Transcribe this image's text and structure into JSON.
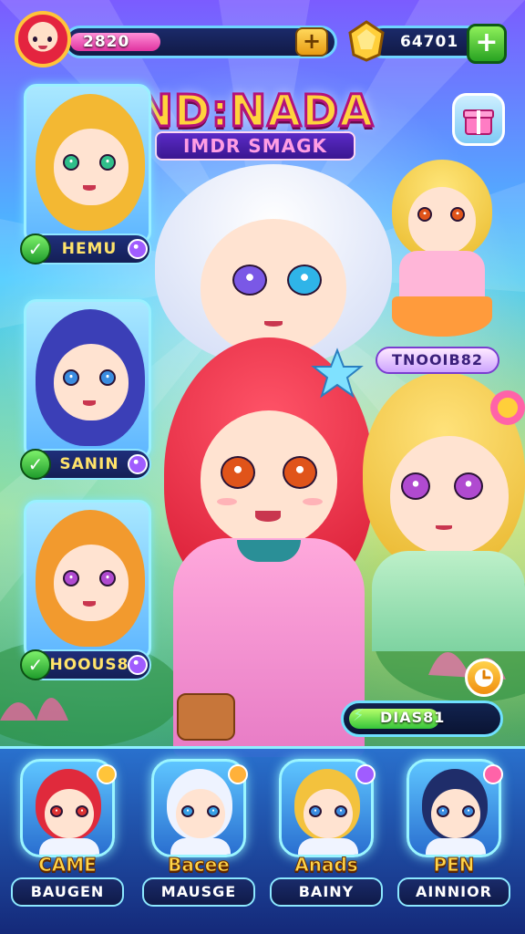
{
  "hud": {
    "energy_value": "2820",
    "energy_fraction": 0.62,
    "coins_value": "64701",
    "energy_plus": "+",
    "coins_plus": "+"
  },
  "title": {
    "main": "ND:NADA",
    "sub": "IMDR SMAGK"
  },
  "left_cards": [
    {
      "label": "HEMU",
      "hair": "#f3b833",
      "eye": "#2fbf8a"
    },
    {
      "label": "SANIN",
      "hair": "#3b3fb7",
      "eye": "#3a8ce0"
    },
    {
      "label": "HOOUS8",
      "hair": "#f29a2e",
      "eye": "#b04ad0"
    }
  ],
  "right_tag": "TNOOIB82",
  "progress": {
    "text": "DIAS81",
    "fraction": 0.62
  },
  "roster": [
    {
      "title": "CAME",
      "sub": "BAUGEN",
      "hair": "#e02a3c",
      "eye": "#d33"
    },
    {
      "title": "Bacee",
      "sub": "MAUSGE",
      "hair": "#eef3ff",
      "eye": "#37a0e6"
    },
    {
      "title": "Anads",
      "sub": "BAINY",
      "hair": "#f3c23d",
      "eye": "#3a8ce0"
    },
    {
      "title": "PEN",
      "sub": "AINNIOR",
      "hair": "#1f2d6a",
      "eye": "#3a8ce0"
    }
  ],
  "icons": {
    "energy_avatar": "red-hair-avatar-icon",
    "coin": "gold-gem-icon",
    "gift": "gift-icon",
    "timer": "clock-icon",
    "check": "check-icon",
    "gem": "gem-icon"
  }
}
